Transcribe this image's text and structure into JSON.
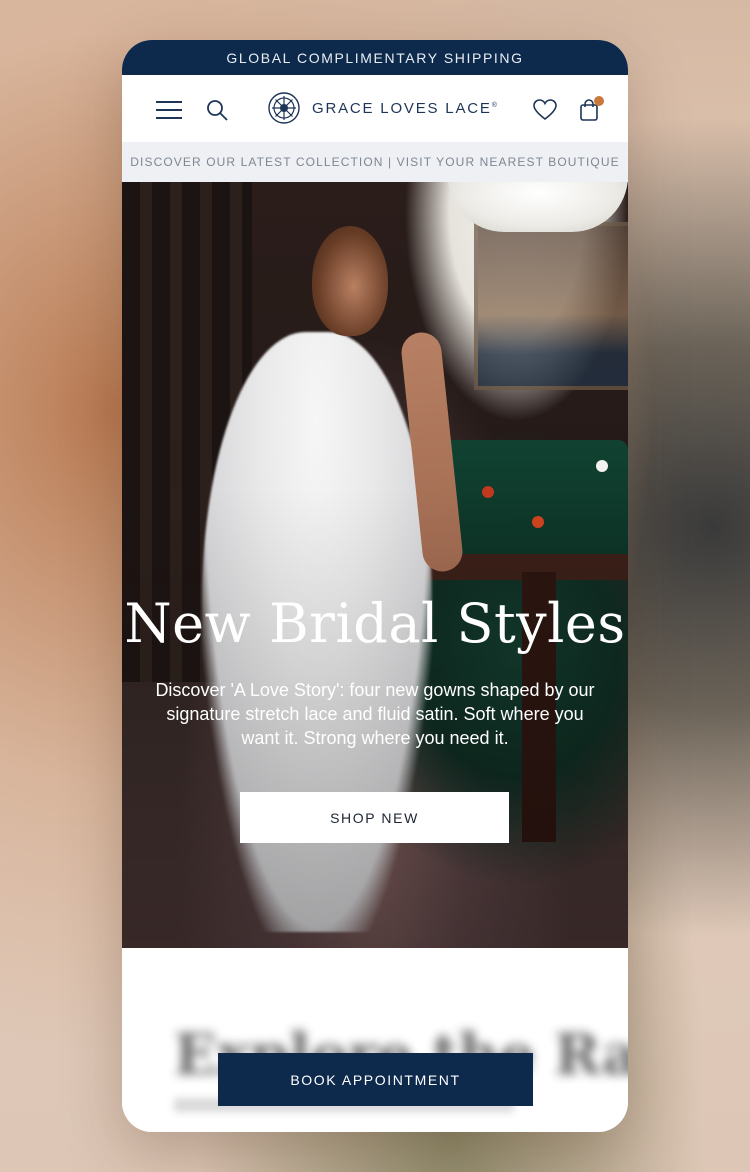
{
  "announcement": "GLOBAL COMPLIMENTARY SHIPPING",
  "header": {
    "brand": "GRACE LOVES LACE",
    "brand_mark": "®",
    "icons": [
      "menu-icon",
      "search-icon",
      "heart-icon",
      "bag-icon"
    ]
  },
  "promo_bar": "DISCOVER OUR LATEST COLLECTION | VISIT YOUR NEAREST BOUTIQUE",
  "hero": {
    "title": "New Bridal Styles",
    "text": "Discover 'A Love Story': four new gowns shaped by our signature stretch lace and fluid satin. Soft where you want it. Strong where you need it.",
    "button": "SHOP NEW"
  },
  "next_section": {
    "title": "Explore the Range"
  },
  "sticky_cta": "BOOK APPOINTMENT",
  "colors": {
    "navy": "#0d2a4c",
    "promo_bg": "#eef0f3",
    "cart_badge": "#c9793c"
  }
}
